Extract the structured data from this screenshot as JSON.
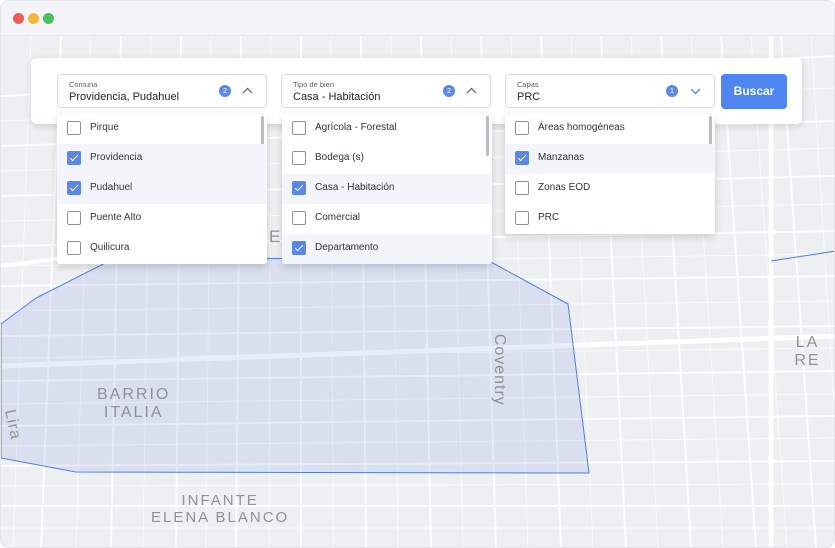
{
  "window": {
    "traffic_lights": [
      "close",
      "minimize",
      "maximize"
    ]
  },
  "map": {
    "labels": {
      "barrio_italia": "BARRIO\nITALIA",
      "lira": "Lira",
      "coventry": "Coventry",
      "infante": "INFANTE\nELENA BLANCO",
      "la_re": "LA RE",
      "e": "E"
    },
    "polygon_color": "#4f7ee8"
  },
  "filters": {
    "comuna": {
      "label": "Comuna",
      "value": "Providencia, Pudahuel",
      "count": "2",
      "options": [
        {
          "label": "Pirque",
          "checked": false
        },
        {
          "label": "Providencia",
          "checked": true
        },
        {
          "label": "Pudahuel",
          "checked": true
        },
        {
          "label": "Puente Alto",
          "checked": false
        },
        {
          "label": "Quilicura",
          "checked": false
        }
      ]
    },
    "tipo": {
      "label": "Tipo de bien",
      "value": "Casa - Habitación",
      "count": "2",
      "options": [
        {
          "label": "Agrícola - Forestal",
          "checked": false
        },
        {
          "label": "Bodega (s)",
          "checked": false
        },
        {
          "label": "Casa - Habitación",
          "checked": true
        },
        {
          "label": "Comercial",
          "checked": false
        },
        {
          "label": "Departamento",
          "checked": true
        }
      ]
    },
    "capas": {
      "label": "Capas",
      "value": "PRC",
      "count": "1",
      "options": [
        {
          "label": "Áreas homogéneas",
          "checked": false
        },
        {
          "label": "Manzanas",
          "checked": true
        },
        {
          "label": "Zonas EOD",
          "checked": false
        },
        {
          "label": "PRC",
          "checked": false
        }
      ]
    }
  },
  "search_button": "Buscar",
  "colors": {
    "accent": "#4e85f0",
    "checkbox": "#5b87e6"
  }
}
